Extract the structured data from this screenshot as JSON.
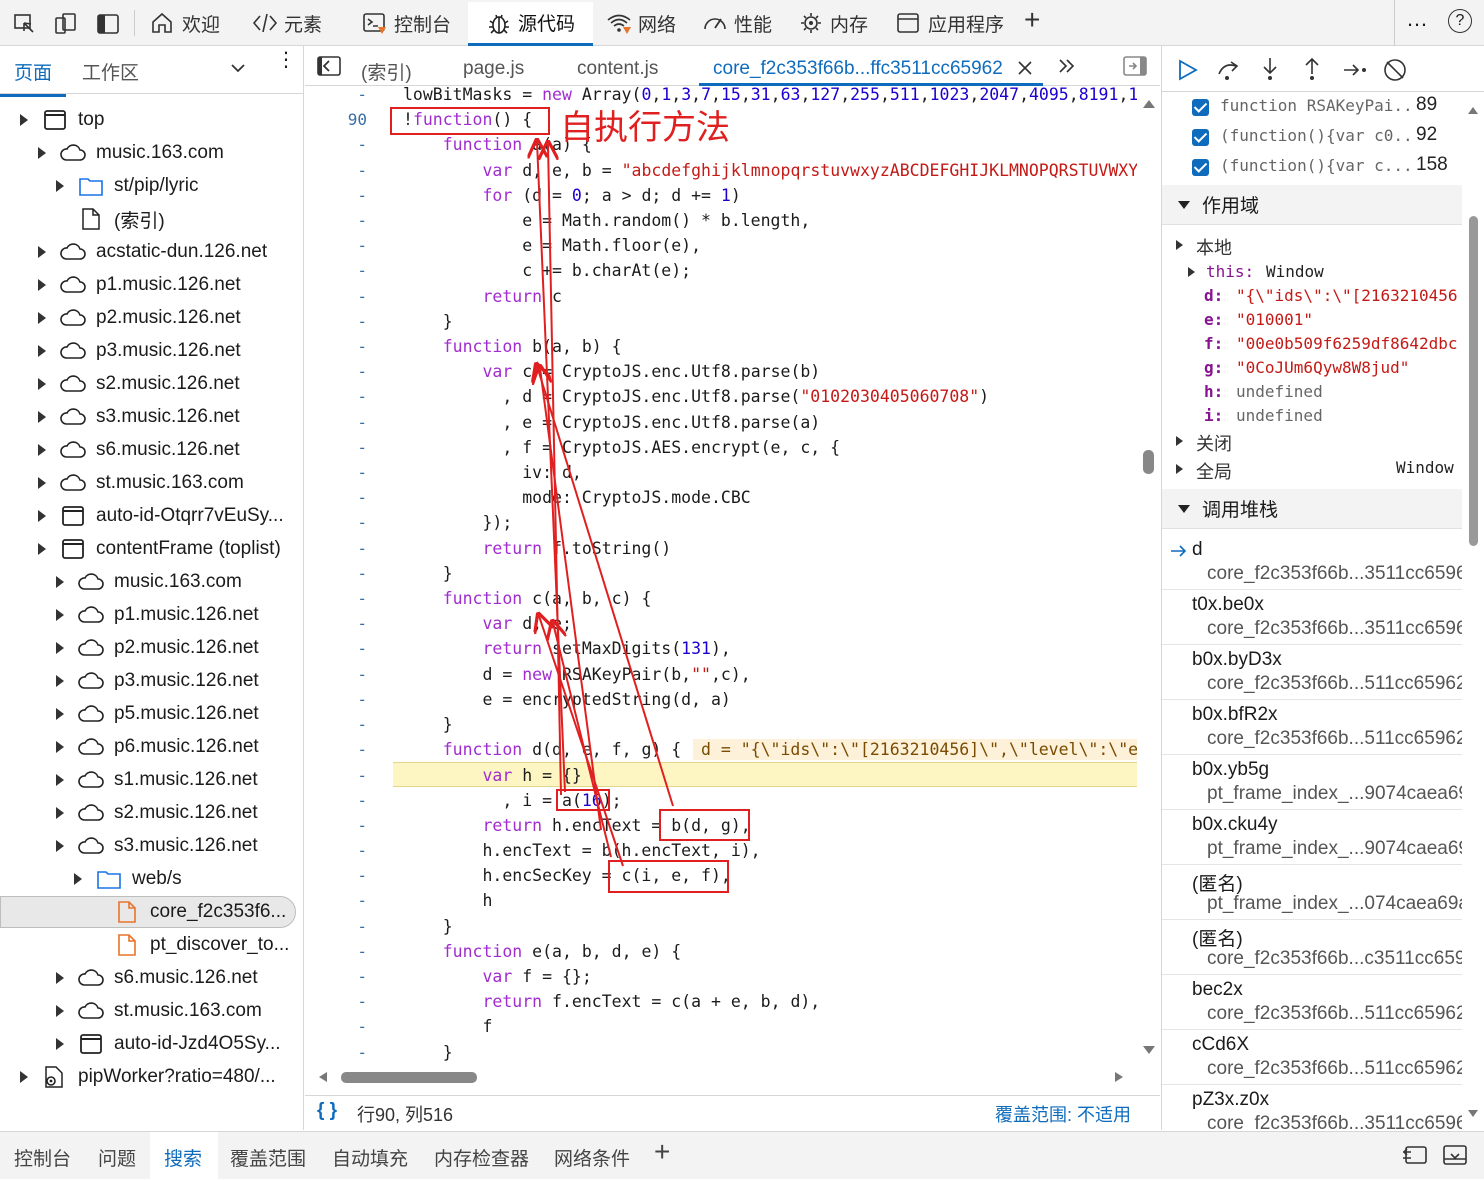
{
  "toolbar": {
    "tabs": [
      {
        "label": "欢迎",
        "icon": "home-icon"
      },
      {
        "label": "元素",
        "icon": "code-tags-icon"
      },
      {
        "label": "控制台",
        "icon": "console-icon"
      },
      {
        "label": "源代码",
        "icon": "bug-icon"
      },
      {
        "label": "网络",
        "icon": "wifi-icon"
      },
      {
        "label": "性能",
        "icon": "gauge-icon"
      },
      {
        "label": "内存",
        "icon": "memory-icon"
      },
      {
        "label": "应用程序",
        "icon": "application-icon"
      }
    ],
    "add_tab": "+",
    "more": "…",
    "help": "?"
  },
  "left": {
    "tabs": [
      "页面",
      "工作区"
    ],
    "tree": [
      {
        "label": "top",
        "icon": "frame-icon",
        "depth": 0,
        "arrow": true
      },
      {
        "label": "music.163.com",
        "icon": "cloud-icon",
        "depth": 1,
        "arrow": true
      },
      {
        "label": "st/pip/lyric",
        "icon": "folder-icon",
        "depth": 2,
        "arrow": true
      },
      {
        "label": "(索引)",
        "icon": "file-icon",
        "depth": 2,
        "arrow": false
      },
      {
        "label": "acstatic-dun.126.net",
        "icon": "cloud-icon",
        "depth": 1,
        "arrow": true
      },
      {
        "label": "p1.music.126.net",
        "icon": "cloud-icon",
        "depth": 1,
        "arrow": true
      },
      {
        "label": "p2.music.126.net",
        "icon": "cloud-icon",
        "depth": 1,
        "arrow": true
      },
      {
        "label": "p3.music.126.net",
        "icon": "cloud-icon",
        "depth": 1,
        "arrow": true
      },
      {
        "label": "s2.music.126.net",
        "icon": "cloud-icon",
        "depth": 1,
        "arrow": true
      },
      {
        "label": "s3.music.126.net",
        "icon": "cloud-icon",
        "depth": 1,
        "arrow": true
      },
      {
        "label": "s6.music.126.net",
        "icon": "cloud-icon",
        "depth": 1,
        "arrow": true
      },
      {
        "label": "st.music.163.com",
        "icon": "cloud-icon",
        "depth": 1,
        "arrow": true
      },
      {
        "label": "auto-id-Otqrr7vEuSy...",
        "icon": "frame-icon",
        "depth": 1,
        "arrow": true
      },
      {
        "label": "contentFrame (toplist)",
        "icon": "frame-icon",
        "depth": 1,
        "arrow": true
      },
      {
        "label": "music.163.com",
        "icon": "cloud-icon",
        "depth": 2,
        "arrow": true
      },
      {
        "label": "p1.music.126.net",
        "icon": "cloud-icon",
        "depth": 2,
        "arrow": true
      },
      {
        "label": "p2.music.126.net",
        "icon": "cloud-icon",
        "depth": 2,
        "arrow": true
      },
      {
        "label": "p3.music.126.net",
        "icon": "cloud-icon",
        "depth": 2,
        "arrow": true
      },
      {
        "label": "p5.music.126.net",
        "icon": "cloud-icon",
        "depth": 2,
        "arrow": true
      },
      {
        "label": "p6.music.126.net",
        "icon": "cloud-icon",
        "depth": 2,
        "arrow": true
      },
      {
        "label": "s1.music.126.net",
        "icon": "cloud-icon",
        "depth": 2,
        "arrow": true
      },
      {
        "label": "s2.music.126.net",
        "icon": "cloud-icon",
        "depth": 2,
        "arrow": true
      },
      {
        "label": "s3.music.126.net",
        "icon": "cloud-icon",
        "depth": 2,
        "arrow": true
      },
      {
        "label": "web/s",
        "icon": "folder-icon",
        "depth": 3,
        "arrow": true
      },
      {
        "label": "core_f2c353f6...",
        "icon": "js-file-icon",
        "depth": 4,
        "arrow": false,
        "selected": true
      },
      {
        "label": "pt_discover_to...",
        "icon": "js-file-icon",
        "depth": 4,
        "arrow": false
      },
      {
        "label": "s6.music.126.net",
        "icon": "cloud-icon",
        "depth": 2,
        "arrow": true
      },
      {
        "label": "st.music.163.com",
        "icon": "cloud-icon",
        "depth": 2,
        "arrow": true
      },
      {
        "label": "auto-id-Jzd4O5Sy...",
        "icon": "frame-icon",
        "depth": 2,
        "arrow": true
      },
      {
        "label": "pipWorker?ratio=480/...",
        "icon": "worker-icon",
        "depth": 0,
        "arrow": true
      }
    ]
  },
  "editor": {
    "tabs": [
      "(索引)",
      "page.js",
      "content.js",
      "core_f2c353f66b...ffc3511cc65962"
    ],
    "annotation": "自执行方法",
    "lines": [
      {
        "num": "-",
        "html": "lowBitMasks = <span class=\"k\">new</span> Array(<span class=\"n\">0</span>,<span class=\"n\">1</span>,<span class=\"n\">3</span>,<span class=\"n\">7</span>,<span class=\"n\">15</span>,<span class=\"n\">31</span>,<span class=\"n\">63</span>,<span class=\"n\">127</span>,<span class=\"n\">255</span>,<span class=\"n\">511</span>,<span class=\"n\">1023</span>,<span class=\"n\">2047</span>,<span class=\"n\">4095</span>,<span class=\"n\">8191</span>,<span class=\"n\">1</span>"
      },
      {
        "num": "90",
        "html": "!<span class=\"k\">function</span>() {"
      },
      {
        "num": "-",
        "html": "    <span class=\"k\">function</span> a(a) {"
      },
      {
        "num": "-",
        "html": "        <span class=\"k\">var</span> d, e, b = <span class=\"s\">\"abcdefghijklmnopqrstuvwxyzABCDEFGHIJKLMNOPQRSTUVWXY</span>"
      },
      {
        "num": "-",
        "html": "        <span class=\"k\">for</span> (d = <span class=\"n\">0</span>; a &gt; d; d += <span class=\"n\">1</span>)"
      },
      {
        "num": "-",
        "html": "            e = Math.random() * b.length,"
      },
      {
        "num": "-",
        "html": "            e = Math.floor(e),"
      },
      {
        "num": "-",
        "html": "            c += b.charAt(e);"
      },
      {
        "num": "-",
        "html": "        <span class=\"k\">return</span> c"
      },
      {
        "num": "-",
        "html": "    }"
      },
      {
        "num": "-",
        "html": "    <span class=\"k\">function</span> b(a, b) {"
      },
      {
        "num": "-",
        "html": "        <span class=\"k\">var</span> c = CryptoJS.enc.Utf8.parse(b)"
      },
      {
        "num": "-",
        "html": "          , d = CryptoJS.enc.Utf8.parse(<span class=\"s\">\"0102030405060708\"</span>)"
      },
      {
        "num": "-",
        "html": "          , e = CryptoJS.enc.Utf8.parse(a)"
      },
      {
        "num": "-",
        "html": "          , f = CryptoJS.AES.encrypt(e, c, {"
      },
      {
        "num": "-",
        "html": "            iv: d,"
      },
      {
        "num": "-",
        "html": "            mode: CryptoJS.mode.CBC"
      },
      {
        "num": "-",
        "html": "        });"
      },
      {
        "num": "-",
        "html": "        <span class=\"k\">return</span> f.toString()"
      },
      {
        "num": "-",
        "html": "    }"
      },
      {
        "num": "-",
        "html": "    <span class=\"k\">function</span> c(a, b, c) {"
      },
      {
        "num": "-",
        "html": "        <span class=\"k\">var</span> d, e;"
      },
      {
        "num": "-",
        "html": "        <span class=\"k\">return</span> setMaxDigits(<span class=\"n\">131</span>),"
      },
      {
        "num": "-",
        "html": "        d = <span class=\"k\">new</span> RSAKeyPair(b,<span class=\"s\">\"\"</span>,c),"
      },
      {
        "num": "-",
        "html": "        e = encryptedString(d, a)"
      },
      {
        "num": "-",
        "html": "    }"
      },
      {
        "num": "-",
        "html": "    <span class=\"k\">function</span> d(d, e, f, g) {"
      },
      {
        "num": "-",
        "html": "        <span class=\"k\">var</span> h = {}"
      },
      {
        "num": "-",
        "html": "          , i = a(<span class=\"n\">16</span>);"
      },
      {
        "num": "-",
        "html": "        <span class=\"k\">return</span> h.encText = b(d, g),"
      },
      {
        "num": "-",
        "html": "        h.encText = b(h.encText, i),"
      },
      {
        "num": "-",
        "html": "        h.encSecKey = c(i, e, f),"
      },
      {
        "num": "-",
        "html": "        h"
      },
      {
        "num": "-",
        "html": "    }"
      },
      {
        "num": "-",
        "html": "    <span class=\"k\">function</span> e(a, b, d, e) {"
      },
      {
        "num": "-",
        "html": "        <span class=\"k\">var</span> f = {};"
      },
      {
        "num": "-",
        "html": "        <span class=\"k\">return</span> f.encText = c(a + e, b, d),"
      },
      {
        "num": "-",
        "html": "        f"
      },
      {
        "num": "-",
        "html": "    }"
      }
    ],
    "inline_value": "d = \"{\\\"ids\\\":\\\"[2163210456]\\\",\\\"level\\\":\\\"e",
    "status_pos": "行90, 列516",
    "status_braces": "{ }",
    "coverage": "覆盖范围: 不适用"
  },
  "right": {
    "breakpoints": [
      {
        "text": "function RSAKeyPai...",
        "line": "89"
      },
      {
        "text": "(function(){var c0...",
        "line": "92"
      },
      {
        "text": "(function(){var c...",
        "line": "158"
      }
    ],
    "scope_title": "作用域",
    "local_title": "本地",
    "this_label": "this:",
    "this_value": "Window",
    "vars": [
      {
        "name": "d:",
        "value": "\"{\\\"ids\\\":\\\"[2163210456"
      },
      {
        "name": "e:",
        "value": "\"010001\""
      },
      {
        "name": "f:",
        "value": "\"00e0b509f6259df8642dbc"
      },
      {
        "name": "g:",
        "value": "\"0CoJUm6Qyw8W8jud\""
      },
      {
        "name": "h:",
        "value": "undefined"
      },
      {
        "name": "i:",
        "value": "undefined"
      }
    ],
    "closure_title": "关闭",
    "global_title": "全局",
    "global_value": "Window",
    "callstack_title": "调用堆栈",
    "stack": [
      {
        "fn": "d",
        "loc": "core_f2c353f66b...3511cc6596",
        "current": true
      },
      {
        "fn": "t0x.be0x",
        "loc": "core_f2c353f66b...3511cc6596"
      },
      {
        "fn": "b0x.byD3x",
        "loc": "core_f2c353f66b...511cc65962"
      },
      {
        "fn": "b0x.bfR2x",
        "loc": "core_f2c353f66b...511cc65962"
      },
      {
        "fn": "b0x.yb5g",
        "loc": "pt_frame_index_...9074caea69"
      },
      {
        "fn": "b0x.cku4y",
        "loc": "pt_frame_index_...9074caea69"
      },
      {
        "fn": "(匿名)",
        "loc": "pt_frame_index_...074caea69a"
      },
      {
        "fn": "(匿名)",
        "loc": "core_f2c353f66b...c3511cc659"
      },
      {
        "fn": "bec2x",
        "loc": "core_f2c353f66b...511cc65962"
      },
      {
        "fn": "cCd6X",
        "loc": "core_f2c353f66b...511cc65962"
      },
      {
        "fn": "pZ3x.z0x",
        "loc": "core_f2c353f66b...3511cc6596"
      }
    ]
  },
  "bottom": {
    "tabs": [
      "控制台",
      "问题",
      "搜索",
      "覆盖范围",
      "自动填充",
      "内存检查器",
      "网络条件"
    ],
    "add": "+"
  },
  "colors": {
    "accent": "#0f6cbd",
    "annotation": "#e02020",
    "keyword": "#a12ccf",
    "string": "#c41a16",
    "number": "#1c00cf",
    "highlight": "#fdf6c3"
  }
}
